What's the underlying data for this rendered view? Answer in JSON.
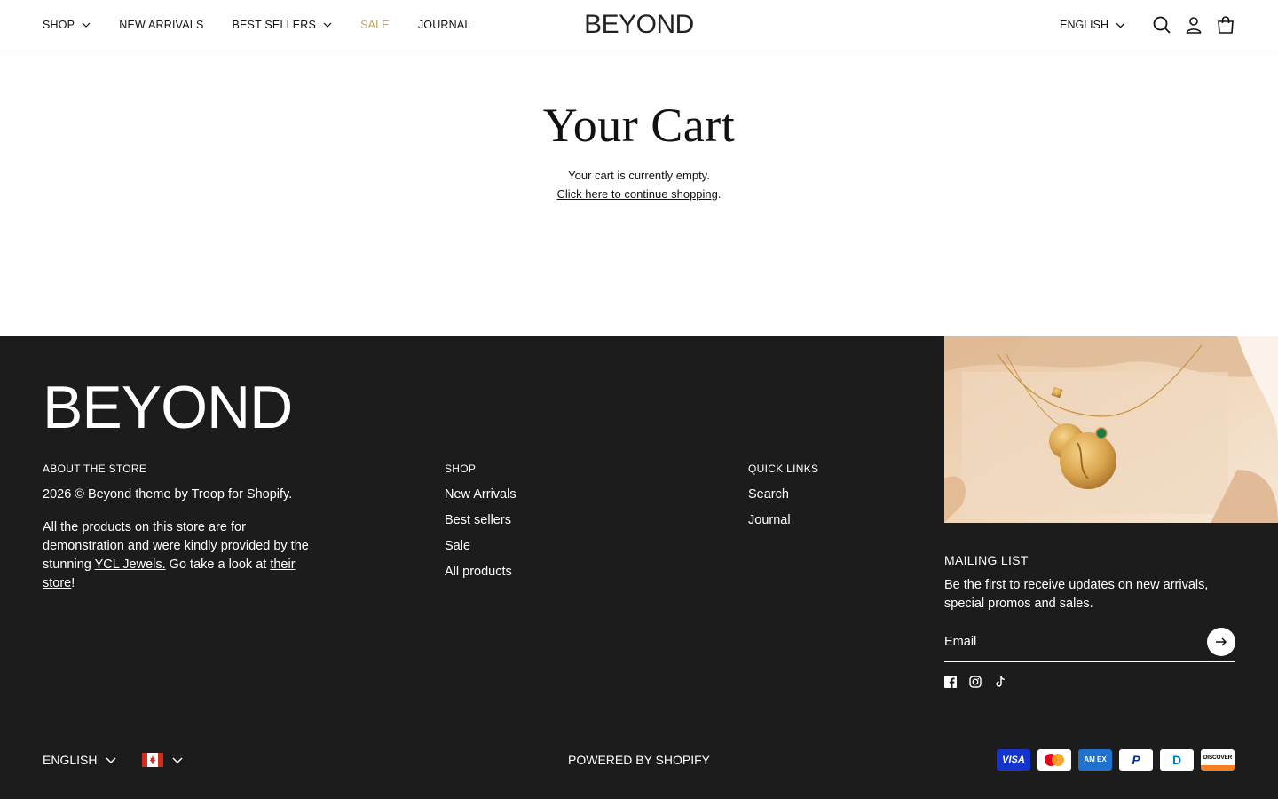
{
  "header": {
    "nav": [
      {
        "label": "SHOP",
        "has_dropdown": true
      },
      {
        "label": "NEW ARRIVALS",
        "has_dropdown": false
      },
      {
        "label": "BEST SELLERS",
        "has_dropdown": true
      },
      {
        "label": "SALE",
        "has_dropdown": false
      },
      {
        "label": "JOURNAL",
        "has_dropdown": false
      }
    ],
    "logo": "BEYOND",
    "language": "ENGLISH",
    "icons": [
      "search-icon",
      "account-icon",
      "cart-icon"
    ]
  },
  "main": {
    "title": "Your Cart",
    "empty_text": "Your cart is currently empty.",
    "continue_link": "Click here to continue shopping",
    "continue_suffix": "."
  },
  "footer": {
    "logo": "BEYOND",
    "about": {
      "heading": "ABOUT THE STORE",
      "copyright": "2026 © Beyond theme by Troop for Shopify.",
      "text_before_link": "All the products on this store are for demonstration and were kindly provided by the stunning ",
      "link1": "YCL Jewels.",
      "text_middle": " Go take a look at ",
      "link2": "their store",
      "text_after": "!"
    },
    "shop": {
      "heading": "SHOP",
      "links": [
        "New Arrivals",
        "Best sellers",
        "Sale",
        "All products"
      ]
    },
    "quick_links": {
      "heading": "QUICK LINKS",
      "links": [
        "Search",
        "Journal"
      ]
    },
    "mailing": {
      "heading": "MAILING LIST",
      "text": "Be the first to receive updates on new arrivals, special promos and sales.",
      "placeholder": "Email"
    },
    "socials": [
      "facebook-icon",
      "instagram-icon",
      "tiktok-icon"
    ],
    "bottom": {
      "language": "ENGLISH",
      "country_flag": "canada-flag-icon",
      "powered": "POWERED BY SHOPIFY",
      "payments": [
        {
          "name": "Visa",
          "label": "VISA",
          "bg": "#1434cb",
          "fg": "#ffffff"
        },
        {
          "name": "Mastercard",
          "label": "",
          "bg": "#ffffff",
          "fg": "#000000"
        },
        {
          "name": "American Express",
          "label": "AM EX",
          "bg": "#1f72cd",
          "fg": "#ffffff"
        },
        {
          "name": "PayPal",
          "label": "P",
          "bg": "#ffffff",
          "fg": "#003087"
        },
        {
          "name": "Diners Club",
          "label": "D",
          "bg": "#ffffff",
          "fg": "#0079be"
        },
        {
          "name": "Discover",
          "label": "DISCOVER",
          "bg": "#ffffff",
          "fg": "#000000"
        }
      ]
    }
  },
  "colors": {
    "sale": "#c8a155",
    "footer_bg": "#1c1c1c"
  }
}
